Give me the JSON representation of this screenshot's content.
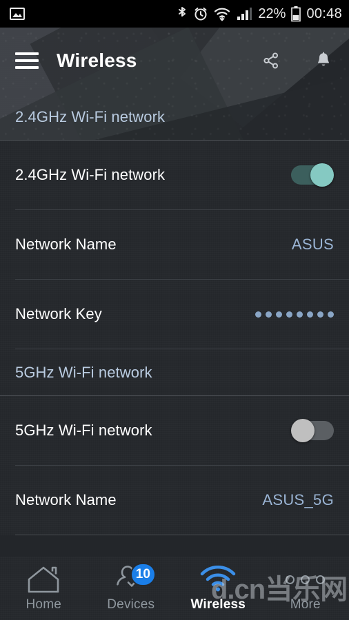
{
  "statusbar": {
    "left_icon": "image-icon",
    "icons": [
      "bluetooth-icon",
      "alarm-icon",
      "wifi-icon",
      "cellular-signal-icon"
    ],
    "battery_percent": "22%",
    "battery_icon": "battery-icon",
    "time": "00:48"
  },
  "appbar": {
    "menu_icon": "hamburger-menu-icon",
    "title": "Wireless",
    "share_icon": "share-icon",
    "bell_icon": "bell-icon"
  },
  "sections": [
    {
      "header": "2.4GHz Wi-Fi network",
      "rows": [
        {
          "label": "2.4GHz Wi-Fi network",
          "type": "toggle",
          "state": "on"
        },
        {
          "label": "Network Name",
          "type": "value",
          "value": "ASUS"
        },
        {
          "label": "Network Key",
          "type": "masked",
          "value": "••••••••",
          "dot_count": 8
        }
      ]
    },
    {
      "header": "5GHz Wi-Fi network",
      "rows": [
        {
          "label": "5GHz Wi-Fi network",
          "type": "toggle",
          "state": "off"
        },
        {
          "label": "Network Name",
          "type": "value",
          "value": "ASUS_5G"
        }
      ]
    }
  ],
  "bottomnav": {
    "items": [
      {
        "label": "Home",
        "icon": "home-icon",
        "active": false,
        "badge": null
      },
      {
        "label": "Devices",
        "icon": "user-check-icon",
        "active": false,
        "badge": "10"
      },
      {
        "label": "Wireless",
        "icon": "wifi-icon",
        "active": true,
        "badge": null
      },
      {
        "label": "More",
        "icon": "more-dots-icon",
        "active": false,
        "badge": null
      }
    ]
  },
  "watermark": {
    "text_latin": "d.cn",
    "text_cjk": "当乐网"
  },
  "colors": {
    "accent_blue": "#1a7ee8",
    "toggle_on_thumb": "#85c9c2",
    "toggle_on_track": "#3c5f5d",
    "toggle_off_thumb": "#bfbfbf",
    "toggle_off_track": "#5b5f63",
    "section_header_text": "#b9cbe0",
    "value_text": "#9ab4d4",
    "panel_bg": "#26292d",
    "statusbar_bg": "#000000"
  }
}
